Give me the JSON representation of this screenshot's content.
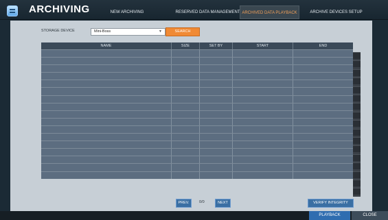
{
  "app": {
    "title": "ARCHIVING"
  },
  "tabs": [
    {
      "label": "NEW ARCHIVING",
      "active": false
    },
    {
      "label": "RESERVED DATA MANAGEMENT",
      "active": false
    },
    {
      "label": "ARCHIVED DATA PLAYBACK",
      "active": true
    },
    {
      "label": "ARCHIVE DEVICES SETUP",
      "active": false
    }
  ],
  "filter": {
    "storage_label": "STORAGE DEVICE",
    "storage_value": "Mini-Boss",
    "search_label": "SEARCH"
  },
  "table": {
    "columns": [
      "NAME",
      "SIZE",
      "SET BY",
      "START",
      "END"
    ],
    "row_count": 17
  },
  "pager": {
    "prev_label": "PREV.",
    "page_indicator": "0/0",
    "next_label": "NEXT",
    "verify_label": "VERIFY INTEGRITY"
  },
  "footer": {
    "playback_label": "PLAYBACK",
    "close_label": "CLOSE"
  },
  "colors": {
    "accent": "#f08a35",
    "active_tab_text": "#f2a15a",
    "table_row": "#5c6d80",
    "button_blue": "#3a6fa3"
  }
}
